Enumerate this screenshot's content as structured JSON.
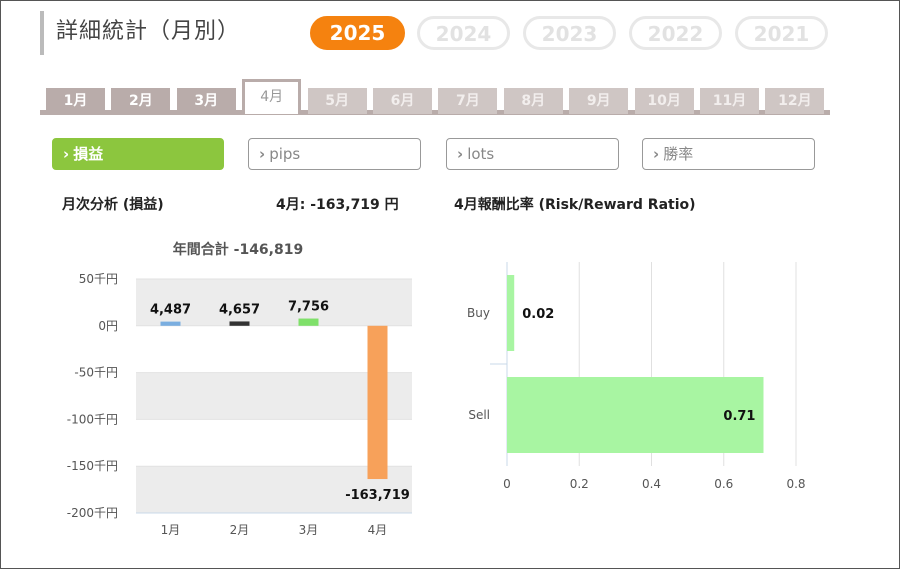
{
  "page": {
    "title": "詳細統計（月別）"
  },
  "years": [
    {
      "label": "2025",
      "active": true
    },
    {
      "label": "2024",
      "active": false
    },
    {
      "label": "2023",
      "active": false
    },
    {
      "label": "2022",
      "active": false
    },
    {
      "label": "2021",
      "active": false
    }
  ],
  "months": [
    {
      "label": "1月",
      "state": "normal"
    },
    {
      "label": "2月",
      "state": "normal"
    },
    {
      "label": "3月",
      "state": "normal"
    },
    {
      "label": "4月",
      "state": "active"
    },
    {
      "label": "5月",
      "state": "disabled"
    },
    {
      "label": "6月",
      "state": "disabled"
    },
    {
      "label": "7月",
      "state": "disabled"
    },
    {
      "label": "8月",
      "state": "disabled"
    },
    {
      "label": "9月",
      "state": "disabled"
    },
    {
      "label": "10月",
      "state": "disabled"
    },
    {
      "label": "11月",
      "state": "disabled"
    },
    {
      "label": "12月",
      "state": "disabled"
    }
  ],
  "metrics": [
    {
      "label": "損益",
      "active": true
    },
    {
      "label": "pips",
      "active": false
    },
    {
      "label": "lots",
      "active": false
    },
    {
      "label": "勝率",
      "active": false
    }
  ],
  "summary": {
    "monthly_heading": "月次分析 (損益)",
    "month_result": "4月:  -163,719 円",
    "ratio_heading": "4月報酬比率 (Risk/Reward Ratio)"
  },
  "colors": {
    "accent": "#f5820f",
    "active_metric": "#8cc63e"
  },
  "chart_data": [
    {
      "type": "bar",
      "title": "年間合計 -146,819",
      "categories": [
        "1月",
        "2月",
        "3月",
        "4月"
      ],
      "values": [
        4487,
        4657,
        7756,
        -163719
      ],
      "value_labels": [
        "4,487",
        "4,657",
        "7,756",
        "-163,719"
      ],
      "bar_colors": [
        "#7aaee0",
        "#333333",
        "#7fe06a",
        "#f7a15a"
      ],
      "yticks": [
        50000,
        0,
        -50000,
        -100000,
        -150000,
        -200000
      ],
      "ytick_labels": [
        "50千円",
        "0円",
        "-50千円",
        "-100千円",
        "-150千円",
        "-200千円"
      ],
      "ylim": [
        -200000,
        50000
      ],
      "grid": true,
      "xlabel": "",
      "ylabel": ""
    },
    {
      "type": "bar",
      "orientation": "horizontal",
      "title": "",
      "categories": [
        "Buy",
        "Sell"
      ],
      "values": [
        0.02,
        0.71
      ],
      "value_labels": [
        "0.02",
        "0.71"
      ],
      "bar_colors": [
        "#a8f5a2",
        "#a8f5a2"
      ],
      "xticks": [
        0,
        0.2,
        0.4,
        0.6,
        0.8
      ],
      "xtick_labels": [
        "0",
        "0.2",
        "0.4",
        "0.6",
        "0.8"
      ],
      "xlim": [
        0,
        0.8
      ],
      "grid": true,
      "xlabel": "",
      "ylabel": ""
    }
  ]
}
